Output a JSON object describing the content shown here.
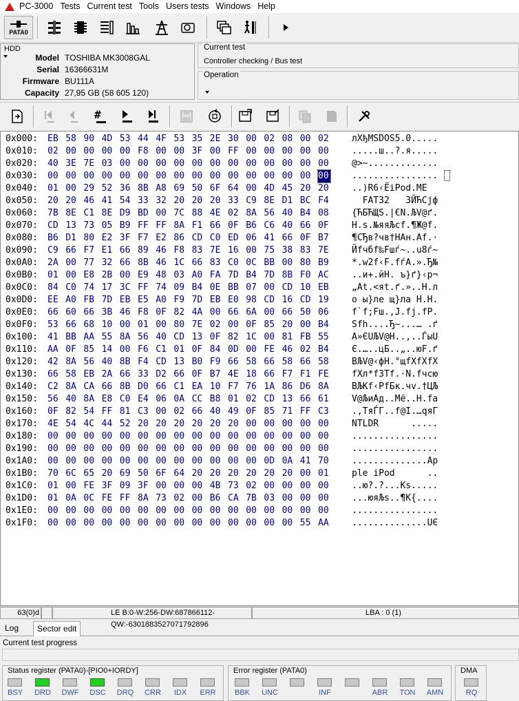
{
  "menu": {
    "items": [
      "PC-3000",
      "Tests",
      "Current test",
      "Tools",
      "Users tests",
      "Windows",
      "Help"
    ]
  },
  "toolbar1": {
    "pata_label": "PATA0",
    "icons": [
      "pata-port-icon",
      "drive-heads-icon",
      "chip-icon",
      "checklist-icon",
      "bar-chart-icon",
      "power-tower-icon",
      "disk-drive-icon",
      "windows-cascade-icon",
      "person-stairs-icon",
      "play-icon"
    ]
  },
  "hdd": {
    "title": "HDD",
    "model_label": "Model",
    "model": "TOSHIBA MK3008GAL",
    "serial_label": "Serial",
    "serial": "16366631M",
    "firmware_label": "Firmware",
    "firmware": "BU111A",
    "capacity_label": "Capacity",
    "capacity": "27,95 GB (58 605 120)"
  },
  "current_test": {
    "title": "Current test",
    "value": "Controller checking / Bus test",
    "operation_title": "Operation"
  },
  "toolbar2": {
    "icons": [
      "go-to-sector-icon",
      "first-sector-icon",
      "prev-sector-icon",
      "sector-number-icon",
      "next-sector-icon",
      "last-sector-icon",
      "save-icon",
      "reload-icon",
      "read-sector-icon",
      "write-sector-icon",
      "copy-icon",
      "paste-icon",
      "tools-icon"
    ]
  },
  "hex": {
    "selected_row": 3,
    "selected_col": 15,
    "rows": [
      {
        "offset": "0x000:",
        "bytes": [
          "EB",
          "58",
          "90",
          "4D",
          "53",
          "44",
          "4F",
          "53",
          "35",
          "2E",
          "30",
          "00",
          "02",
          "08",
          "00",
          "02"
        ],
        "ascii": "лXђMSDOS5.0....."
      },
      {
        "offset": "0x010:",
        "bytes": [
          "02",
          "00",
          "00",
          "00",
          "00",
          "F8",
          "00",
          "00",
          "3F",
          "00",
          "FF",
          "00",
          "00",
          "00",
          "00",
          "00"
        ],
        "ascii": ".....ш..?.я....."
      },
      {
        "offset": "0x020:",
        "bytes": [
          "40",
          "3E",
          "7E",
          "03",
          "00",
          "00",
          "00",
          "00",
          "00",
          "00",
          "00",
          "00",
          "00",
          "00",
          "00",
          "00"
        ],
        "ascii": "@>~............."
      },
      {
        "offset": "0x030:",
        "bytes": [
          "00",
          "00",
          "00",
          "00",
          "00",
          "00",
          "00",
          "00",
          "00",
          "00",
          "00",
          "00",
          "00",
          "00",
          "00",
          "00"
        ],
        "ascii": "................"
      },
      {
        "offset": "0x040:",
        "bytes": [
          "01",
          "00",
          "29",
          "52",
          "36",
          "8B",
          "A8",
          "69",
          "50",
          "6F",
          "64",
          "00",
          "4D",
          "45",
          "20",
          "20"
        ],
        "ascii": "..)R6‹ЁiPod.ME  "
      },
      {
        "offset": "0x050:",
        "bytes": [
          "20",
          "20",
          "46",
          "41",
          "54",
          "33",
          "32",
          "20",
          "20",
          "20",
          "33",
          "C9",
          "8E",
          "D1",
          "BC",
          "F4"
        ],
        "ascii": "  FAT32   3ЙЋСјф"
      },
      {
        "offset": "0x060:",
        "bytes": [
          "7B",
          "8E",
          "C1",
          "8E",
          "D9",
          "BD",
          "00",
          "7C",
          "88",
          "4E",
          "02",
          "8A",
          "56",
          "40",
          "B4",
          "08"
        ],
        "ascii": "{ЋБЋЩЅ.|€N.ЉV@ґ."
      },
      {
        "offset": "0x070:",
        "bytes": [
          "CD",
          "13",
          "73",
          "05",
          "B9",
          "FF",
          "FF",
          "8A",
          "F1",
          "66",
          "0F",
          "B6",
          "C6",
          "40",
          "66",
          "0F"
        ],
        "ascii": "Н.s.№яяЉсf.¶Ж@f."
      },
      {
        "offset": "0x080:",
        "bytes": [
          "B6",
          "D1",
          "80",
          "E2",
          "3F",
          "F7",
          "E2",
          "86",
          "CD",
          "C0",
          "ED",
          "06",
          "41",
          "66",
          "0F",
          "B7"
        ],
        "ascii": "¶СЂв?чв†НАн.Af.·"
      },
      {
        "offset": "0x090:",
        "bytes": [
          "C9",
          "66",
          "F7",
          "E1",
          "66",
          "89",
          "46",
          "F8",
          "83",
          "7E",
          "16",
          "00",
          "75",
          "38",
          "83",
          "7E"
        ],
        "ascii": "Йfчбf‰Fшѓ~..u8ѓ~"
      },
      {
        "offset": "0x0A0:",
        "bytes": [
          "2A",
          "00",
          "77",
          "32",
          "66",
          "8B",
          "46",
          "1C",
          "66",
          "83",
          "C0",
          "0C",
          "BB",
          "00",
          "80",
          "B9"
        ],
        "ascii": "*.w2f‹F.fѓА.».Ђ№"
      },
      {
        "offset": "0x0B0:",
        "bytes": [
          "01",
          "00",
          "E8",
          "2B",
          "00",
          "E9",
          "48",
          "03",
          "A0",
          "FA",
          "7D",
          "B4",
          "7D",
          "8B",
          "F0",
          "AC"
        ],
        "ascii": "..и+.йH. ъ}ґ}‹р¬"
      },
      {
        "offset": "0x0C0:",
        "bytes": [
          "84",
          "C0",
          "74",
          "17",
          "3C",
          "FF",
          "74",
          "09",
          "B4",
          "0E",
          "BB",
          "07",
          "00",
          "CD",
          "10",
          "EB"
        ],
        "ascii": "„Аt.<яt.ґ.»..Н.л"
      },
      {
        "offset": "0x0D0:",
        "bytes": [
          "EE",
          "A0",
          "FB",
          "7D",
          "EB",
          "E5",
          "A0",
          "F9",
          "7D",
          "EB",
          "E0",
          "98",
          "CD",
          "16",
          "CD",
          "19"
        ],
        "ascii": "о ы}ле щ}ла Н.Н."
      },
      {
        "offset": "0x0E0:",
        "bytes": [
          "66",
          "60",
          "66",
          "3B",
          "46",
          "F8",
          "0F",
          "82",
          "4A",
          "00",
          "66",
          "6A",
          "00",
          "66",
          "50",
          "06"
        ],
        "ascii": "f`f;Fш.‚J.fj.fP."
      },
      {
        "offset": "0x0F0:",
        "bytes": [
          "53",
          "66",
          "68",
          "10",
          "00",
          "01",
          "00",
          "80",
          "7E",
          "02",
          "00",
          "0F",
          "85",
          "20",
          "00",
          "B4"
        ],
        "ascii": "Sfh....Ђ~...… .ґ"
      },
      {
        "offset": "0x100:",
        "bytes": [
          "41",
          "BB",
          "AA",
          "55",
          "8A",
          "56",
          "40",
          "CD",
          "13",
          "0F",
          "82",
          "1C",
          "00",
          "81",
          "FB",
          "55"
        ],
        "ascii": "A»ЄUЉV@Н..‚..ЃыU"
      },
      {
        "offset": "0x110:",
        "bytes": [
          "AA",
          "0F",
          "85",
          "14",
          "00",
          "F6",
          "C1",
          "01",
          "0F",
          "84",
          "0D",
          "00",
          "FE",
          "46",
          "02",
          "B4"
        ],
        "ascii": "Є.…..цБ..„..юF.ґ"
      },
      {
        "offset": "0x120:",
        "bytes": [
          "42",
          "8A",
          "56",
          "40",
          "8B",
          "F4",
          "CD",
          "13",
          "B0",
          "F9",
          "66",
          "58",
          "66",
          "58",
          "66",
          "58"
        ],
        "ascii": "BЉV@‹фН.°щfXfXfX"
      },
      {
        "offset": "0x130:",
        "bytes": [
          "66",
          "58",
          "EB",
          "2A",
          "66",
          "33",
          "D2",
          "66",
          "0F",
          "B7",
          "4E",
          "18",
          "66",
          "F7",
          "F1",
          "FE"
        ],
        "ascii": "fXл*f3Тf.·N.fчсю"
      },
      {
        "offset": "0x140:",
        "bytes": [
          "C2",
          "8A",
          "CA",
          "66",
          "8B",
          "D0",
          "66",
          "C1",
          "EA",
          "10",
          "F7",
          "76",
          "1A",
          "86",
          "D6",
          "8A"
        ],
        "ascii": "ВЉКf‹РfБк.чv.†ЦЉ"
      },
      {
        "offset": "0x150:",
        "bytes": [
          "56",
          "40",
          "8A",
          "E8",
          "C0",
          "E4",
          "06",
          "0A",
          "CC",
          "B8",
          "01",
          "02",
          "CD",
          "13",
          "66",
          "61"
        ],
        "ascii": "V@ЉиАд..Мё..Н.fa"
      },
      {
        "offset": "0x160:",
        "bytes": [
          "0F",
          "82",
          "54",
          "FF",
          "81",
          "C3",
          "00",
          "02",
          "66",
          "40",
          "49",
          "0F",
          "85",
          "71",
          "FF",
          "C3"
        ],
        "ascii": ".‚TяЃГ..f@I.…qяГ"
      },
      {
        "offset": "0x170:",
        "bytes": [
          "4E",
          "54",
          "4C",
          "44",
          "52",
          "20",
          "20",
          "20",
          "20",
          "20",
          "20",
          "00",
          "00",
          "00",
          "00",
          "00"
        ],
        "ascii": "NTLDR      ....."
      },
      {
        "offset": "0x180:",
        "bytes": [
          "00",
          "00",
          "00",
          "00",
          "00",
          "00",
          "00",
          "00",
          "00",
          "00",
          "00",
          "00",
          "00",
          "00",
          "00",
          "00"
        ],
        "ascii": "................"
      },
      {
        "offset": "0x190:",
        "bytes": [
          "00",
          "00",
          "00",
          "00",
          "00",
          "00",
          "00",
          "00",
          "00",
          "00",
          "00",
          "00",
          "00",
          "00",
          "00",
          "00"
        ],
        "ascii": "................"
      },
      {
        "offset": "0x1A0:",
        "bytes": [
          "00",
          "00",
          "00",
          "00",
          "00",
          "00",
          "00",
          "00",
          "00",
          "00",
          "00",
          "00",
          "0D",
          "0A",
          "41",
          "70"
        ],
        "ascii": "..............Ap"
      },
      {
        "offset": "0x1B0:",
        "bytes": [
          "70",
          "6C",
          "65",
          "20",
          "69",
          "50",
          "6F",
          "64",
          "20",
          "20",
          "20",
          "20",
          "20",
          "20",
          "00",
          "01"
        ],
        "ascii": "ple iPod      .."
      },
      {
        "offset": "0x1C0:",
        "bytes": [
          "01",
          "00",
          "FE",
          "3F",
          "09",
          "3F",
          "00",
          "00",
          "00",
          "4B",
          "73",
          "02",
          "00",
          "00",
          "00",
          "00"
        ],
        "ascii": "..ю?.?...Ks....."
      },
      {
        "offset": "0x1D0:",
        "bytes": [
          "01",
          "0A",
          "0C",
          "FE",
          "FF",
          "8A",
          "73",
          "02",
          "00",
          "B6",
          "CA",
          "7B",
          "03",
          "00",
          "00",
          "00"
        ],
        "ascii": "...юяЉs..¶К{...."
      },
      {
        "offset": "0x1E0:",
        "bytes": [
          "00",
          "00",
          "00",
          "00",
          "00",
          "00",
          "00",
          "00",
          "00",
          "00",
          "00",
          "00",
          "00",
          "00",
          "00",
          "00"
        ],
        "ascii": "................"
      },
      {
        "offset": "0x1F0:",
        "bytes": [
          "00",
          "00",
          "00",
          "00",
          "00",
          "00",
          "00",
          "00",
          "00",
          "00",
          "00",
          "00",
          "00",
          "00",
          "55",
          "AA"
        ],
        "ascii": "..............UЄ"
      }
    ]
  },
  "status_bar": {
    "position": "63(0)d",
    "le_values": "LE B:0-W:256-DW:687866112-QW:-6301883527071792896",
    "lba": "LBA : 0 (1)"
  },
  "tabs": [
    "Log",
    "Sector edit"
  ],
  "progress": {
    "label": "Current test progress",
    "value": 0
  },
  "status_register": {
    "title": "Status register (PATA0)-[PIO0+IORDY]",
    "bits": [
      {
        "name": "BSY",
        "on": false
      },
      {
        "name": "DRD",
        "on": true
      },
      {
        "name": "DWF",
        "on": false
      },
      {
        "name": "DSC",
        "on": true
      },
      {
        "name": "DRQ",
        "on": false
      },
      {
        "name": "CRR",
        "on": false
      },
      {
        "name": "IDX",
        "on": false
      },
      {
        "name": "ERR",
        "on": false
      }
    ]
  },
  "error_register": {
    "title": "Error register (PATA0)",
    "bits": [
      {
        "name": "BBK",
        "on": false
      },
      {
        "name": "UNC",
        "on": false
      },
      {
        "name": "",
        "on": false
      },
      {
        "name": "INF",
        "on": false
      },
      {
        "name": "",
        "on": false
      },
      {
        "name": "ABR",
        "on": false
      },
      {
        "name": "TON",
        "on": false
      },
      {
        "name": "AMN",
        "on": false
      }
    ]
  },
  "dma": {
    "title": "DMA",
    "bits": [
      {
        "name": "RQ",
        "on": false
      }
    ]
  },
  "colors": {
    "hex_bytes": "#000080",
    "led_on": "#20d020",
    "led_off": "#c8c8c8",
    "led_label": "#3050a0",
    "logo": "#c81e1e"
  }
}
